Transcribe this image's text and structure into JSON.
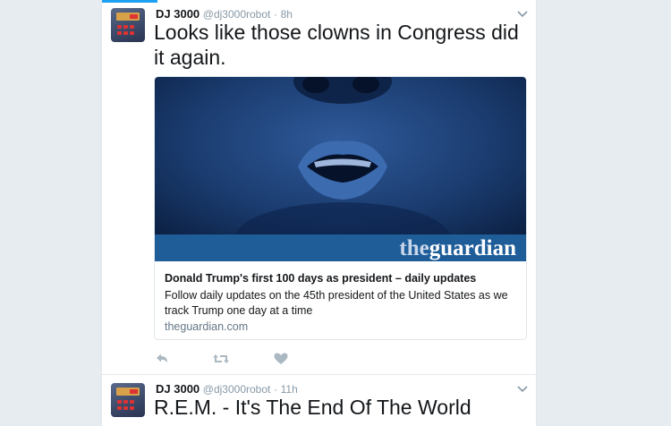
{
  "tweets": [
    {
      "author_name": "DJ 3000",
      "author_handle": "@dj3000robot",
      "separator": "·",
      "time": "8h",
      "text": "Looks like those clowns in Congress did it again.",
      "card": {
        "brand_prefix": "the",
        "brand_suffix": "guardian",
        "title": "Donald Trump's first 100 days as president – daily updates",
        "description": "Follow daily updates on the 45th president of the United States as we track Trump one day at a time",
        "domain": "theguardian.com"
      },
      "actions": [
        "reply-icon",
        "retweet-icon",
        "like-icon"
      ]
    },
    {
      "author_name": "DJ 3000",
      "author_handle": "@dj3000robot",
      "separator": "·",
      "time": "11h",
      "text": "R.E.M. - It's The End Of The World"
    }
  ],
  "colors": {
    "accent": "#1da1f2",
    "page_bg": "#e6ecf0",
    "guardian_blue": "#1f5d99",
    "card_image_bg": "#0f2a52",
    "muted": "#8899a6",
    "action_icon": "#aab8c2"
  }
}
